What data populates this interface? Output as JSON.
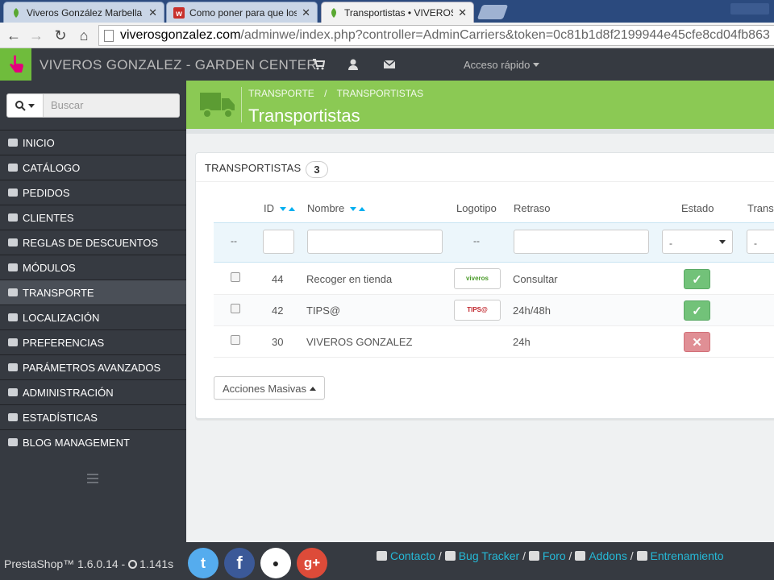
{
  "browser": {
    "tabs": [
      {
        "title": "Viveros González Marbella",
        "active": false
      },
      {
        "title": "Como poner para que los",
        "active": false
      },
      {
        "title": "Transportistas • VIVEROS",
        "active": true
      }
    ],
    "close_glyph": "✕",
    "url_host": "viverosgonzalez.com",
    "url_path": "/adminwe/index.php?controller=AdminCarriers&token=0c81b1d8f2199944e45cfe8cd04fb863"
  },
  "header": {
    "shop_name": "VIVEROS GONZALEZ - GARDEN CENTER",
    "quick_access": "Acceso rápido"
  },
  "sidebar": {
    "search_placeholder": "Buscar",
    "items": [
      {
        "label": "Inicio",
        "icon": "dashboard-icon"
      },
      {
        "label": "Catálogo",
        "icon": "book-icon"
      },
      {
        "label": "Pedidos",
        "icon": "credit-card-icon"
      },
      {
        "label": "Clientes",
        "icon": "users-icon"
      },
      {
        "label": "Reglas de descuentos",
        "icon": "tags-icon"
      },
      {
        "label": "Módulos",
        "icon": "puzzle-icon"
      },
      {
        "label": "Transporte",
        "icon": "truck-icon"
      },
      {
        "label": "Localización",
        "icon": "globe-icon"
      },
      {
        "label": "Preferencias",
        "icon": "wrench-icon"
      },
      {
        "label": "Parámetros avanzados",
        "icon": "cogs-icon"
      },
      {
        "label": "Administración",
        "icon": "cog-icon"
      },
      {
        "label": "Estadísticas",
        "icon": "bar-chart-icon"
      },
      {
        "label": "Blog Management",
        "icon": "pencil-icon"
      }
    ],
    "active_index": 6
  },
  "toolbar": {
    "breadcrumb": [
      "TRANSPORTE",
      "TRANSPORTISTAS"
    ],
    "breadcrumb_sep": "/",
    "title": "Transportistas"
  },
  "panel": {
    "heading": "TRANSPORTISTAS",
    "count": "3",
    "columns": {
      "id": "ID",
      "name": "Nombre",
      "logo": "Logotipo",
      "delay": "Retraso",
      "status": "Estado",
      "transit": "Trans"
    },
    "filters": {
      "id_dash": "--",
      "logo_dash": "--",
      "status_value": "-",
      "transit_value": "-"
    },
    "rows": [
      {
        "id": "44",
        "name": "Recoger en tienda",
        "logo": "viveros gonzalez",
        "delay": "Consultar",
        "active": true
      },
      {
        "id": "42",
        "name": "TIPS@",
        "logo": "TIPS@",
        "delay": "24h/48h",
        "active": true
      },
      {
        "id": "30",
        "name": "VIVEROS GONZALEZ",
        "logo": "",
        "delay": "24h",
        "active": false
      }
    ],
    "bulk_actions": "Acciones Masivas"
  },
  "footer": {
    "version": "PrestaShop™ 1.6.0.14 - ",
    "load_time": "1.141s",
    "social": [
      "twitter-icon",
      "facebook-icon",
      "github-icon",
      "google-plus-icon"
    ],
    "links": [
      "Contacto",
      "Bug Tracker",
      "Foro",
      "Addons",
      "Entrenamiento"
    ]
  },
  "colors": {
    "toolbar_green": "#8bc954",
    "sidebar_dark": "#363a41",
    "accent_blue": "#00aff0",
    "status_on": "#72c279",
    "status_off": "#e08f95"
  }
}
